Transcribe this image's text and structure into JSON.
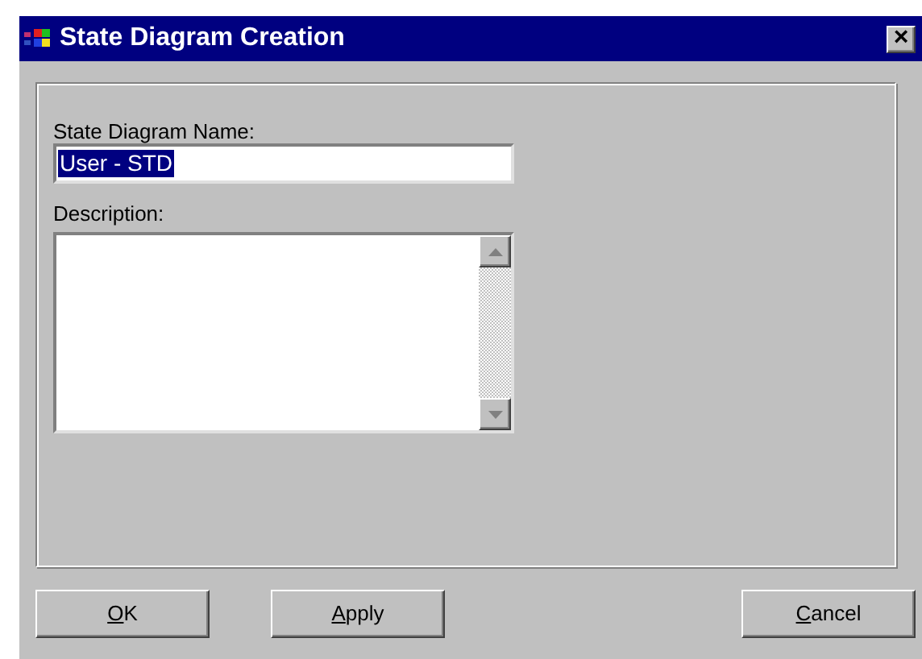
{
  "window": {
    "title": "State Diagram Creation",
    "close": "×"
  },
  "name_field": {
    "label": "State Diagram Name:",
    "value": "User - STD",
    "selected": true
  },
  "description_field": {
    "label": "Description:"
  },
  "buttons": [
    {
      "label": "OK"
    },
    {
      "label": "Apply"
    },
    {
      "label": "Cancel"
    }
  ]
}
